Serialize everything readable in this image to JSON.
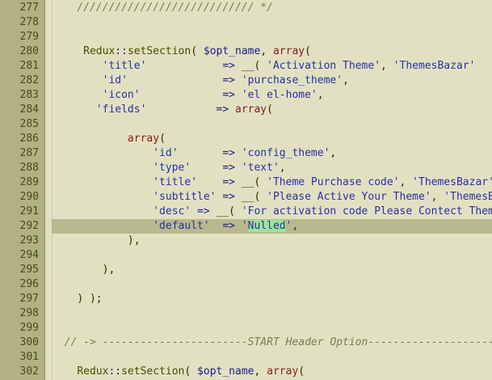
{
  "editor": {
    "lines": [
      {
        "n": "277",
        "tokens": [
          {
            "t": "    ",
            "c": "plain"
          },
          {
            "t": "//////////////////////////// */",
            "c": "cmt"
          }
        ]
      },
      {
        "n": "278",
        "tokens": []
      },
      {
        "n": "279",
        "tokens": []
      },
      {
        "n": "280",
        "tokens": [
          {
            "t": "     ",
            "c": "plain"
          },
          {
            "t": "Redux",
            "c": "fn"
          },
          {
            "t": "::",
            "c": "op"
          },
          {
            "t": "setSection",
            "c": "fn"
          },
          {
            "t": "( ",
            "c": "plain"
          },
          {
            "t": "$opt_name",
            "c": "var"
          },
          {
            "t": ", ",
            "c": "plain"
          },
          {
            "t": "array",
            "c": "kw"
          },
          {
            "t": "(",
            "c": "plain"
          }
        ]
      },
      {
        "n": "281",
        "tokens": [
          {
            "t": "        ",
            "c": "plain"
          },
          {
            "t": "'title'",
            "c": "str"
          },
          {
            "t": "            ",
            "c": "plain"
          },
          {
            "t": "=>",
            "c": "op"
          },
          {
            "t": " __( ",
            "c": "plain"
          },
          {
            "t": "'Activation Theme'",
            "c": "str"
          },
          {
            "t": ", ",
            "c": "plain"
          },
          {
            "t": "'ThemesBazar'",
            "c": "str"
          }
        ]
      },
      {
        "n": "282",
        "tokens": [
          {
            "t": "        ",
            "c": "plain"
          },
          {
            "t": "'id'",
            "c": "str"
          },
          {
            "t": "               ",
            "c": "plain"
          },
          {
            "t": "=>",
            "c": "op"
          },
          {
            "t": " ",
            "c": "plain"
          },
          {
            "t": "'purchase_theme'",
            "c": "str"
          },
          {
            "t": ",",
            "c": "plain"
          }
        ]
      },
      {
        "n": "283",
        "tokens": [
          {
            "t": "        ",
            "c": "plain"
          },
          {
            "t": "'icon'",
            "c": "str"
          },
          {
            "t": "             ",
            "c": "plain"
          },
          {
            "t": "=>",
            "c": "op"
          },
          {
            "t": " ",
            "c": "plain"
          },
          {
            "t": "'el el-home'",
            "c": "str"
          },
          {
            "t": ",",
            "c": "plain"
          }
        ]
      },
      {
        "n": "284",
        "tokens": [
          {
            "t": "       ",
            "c": "plain"
          },
          {
            "t": "'fields'",
            "c": "str"
          },
          {
            "t": "           ",
            "c": "plain"
          },
          {
            "t": "=>",
            "c": "op"
          },
          {
            "t": " ",
            "c": "plain"
          },
          {
            "t": "array",
            "c": "kw"
          },
          {
            "t": "(",
            "c": "plain"
          }
        ]
      },
      {
        "n": "285",
        "tokens": []
      },
      {
        "n": "286",
        "tokens": [
          {
            "t": "            ",
            "c": "plain"
          },
          {
            "t": "array",
            "c": "kw"
          },
          {
            "t": "(",
            "c": "plain"
          }
        ]
      },
      {
        "n": "287",
        "tokens": [
          {
            "t": "                ",
            "c": "plain"
          },
          {
            "t": "'id'",
            "c": "str"
          },
          {
            "t": "       ",
            "c": "plain"
          },
          {
            "t": "=>",
            "c": "op"
          },
          {
            "t": " ",
            "c": "plain"
          },
          {
            "t": "'config_theme'",
            "c": "str"
          },
          {
            "t": ",",
            "c": "plain"
          }
        ]
      },
      {
        "n": "288",
        "tokens": [
          {
            "t": "                ",
            "c": "plain"
          },
          {
            "t": "'type'",
            "c": "str"
          },
          {
            "t": "     ",
            "c": "plain"
          },
          {
            "t": "=>",
            "c": "op"
          },
          {
            "t": " ",
            "c": "plain"
          },
          {
            "t": "'text'",
            "c": "str"
          },
          {
            "t": ",",
            "c": "plain"
          }
        ]
      },
      {
        "n": "289",
        "tokens": [
          {
            "t": "                ",
            "c": "plain"
          },
          {
            "t": "'title'",
            "c": "str"
          },
          {
            "t": "    ",
            "c": "plain"
          },
          {
            "t": "=>",
            "c": "op"
          },
          {
            "t": " __( ",
            "c": "plain"
          },
          {
            "t": "'Theme Purchase code'",
            "c": "str"
          },
          {
            "t": ", ",
            "c": "plain"
          },
          {
            "t": "'ThemesBazar'",
            "c": "str"
          }
        ]
      },
      {
        "n": "290",
        "tokens": [
          {
            "t": "                ",
            "c": "plain"
          },
          {
            "t": "'subtitle'",
            "c": "str"
          },
          {
            "t": " ",
            "c": "plain"
          },
          {
            "t": "=>",
            "c": "op"
          },
          {
            "t": " __( ",
            "c": "plain"
          },
          {
            "t": "'Please Active Your Theme'",
            "c": "str"
          },
          {
            "t": ", ",
            "c": "plain"
          },
          {
            "t": "'ThemesBazar'",
            "c": "str"
          }
        ]
      },
      {
        "n": "291",
        "tokens": [
          {
            "t": "                ",
            "c": "plain"
          },
          {
            "t": "'desc'",
            "c": "str"
          },
          {
            "t": " ",
            "c": "plain"
          },
          {
            "t": "=>",
            "c": "op"
          },
          {
            "t": " __( ",
            "c": "plain"
          },
          {
            "t": "'For activation code Please Contect ThemesBazar'",
            "c": "str"
          }
        ]
      },
      {
        "n": "292",
        "highlight": true,
        "tokens": [
          {
            "t": "                ",
            "c": "plain"
          },
          {
            "t": "'default'",
            "c": "str"
          },
          {
            "t": "  ",
            "c": "plain"
          },
          {
            "t": "=>",
            "c": "op"
          },
          {
            "t": " '",
            "c": "str"
          },
          {
            "t": "Nulled",
            "c": "str sel"
          },
          {
            "t": "'",
            "c": "str"
          },
          {
            "t": ",",
            "c": "plain"
          }
        ]
      },
      {
        "n": "293",
        "tokens": [
          {
            "t": "            ",
            "c": "plain"
          },
          {
            "t": "),",
            "c": "plain"
          }
        ]
      },
      {
        "n": "294",
        "tokens": []
      },
      {
        "n": "295",
        "tokens": [
          {
            "t": "        ",
            "c": "plain"
          },
          {
            "t": "),",
            "c": "plain"
          }
        ]
      },
      {
        "n": "296",
        "tokens": []
      },
      {
        "n": "297",
        "tokens": [
          {
            "t": "    ",
            "c": "plain"
          },
          {
            "t": ") );",
            "c": "plain"
          }
        ]
      },
      {
        "n": "298",
        "tokens": []
      },
      {
        "n": "299",
        "tokens": []
      },
      {
        "n": "300",
        "tokens": [
          {
            "t": "  ",
            "c": "plain"
          },
          {
            "t": "// -> -----------------------START Header Option------------------------------",
            "c": "cmt"
          }
        ]
      },
      {
        "n": "301",
        "tokens": []
      },
      {
        "n": "302",
        "tokens": [
          {
            "t": "    ",
            "c": "plain"
          },
          {
            "t": "Redux",
            "c": "fn"
          },
          {
            "t": "::",
            "c": "op"
          },
          {
            "t": "setSection",
            "c": "fn"
          },
          {
            "t": "( ",
            "c": "plain"
          },
          {
            "t": "$opt_name",
            "c": "var"
          },
          {
            "t": ", ",
            "c": "plain"
          },
          {
            "t": "array",
            "c": "kw"
          },
          {
            "t": "(",
            "c": "plain"
          }
        ]
      }
    ]
  }
}
